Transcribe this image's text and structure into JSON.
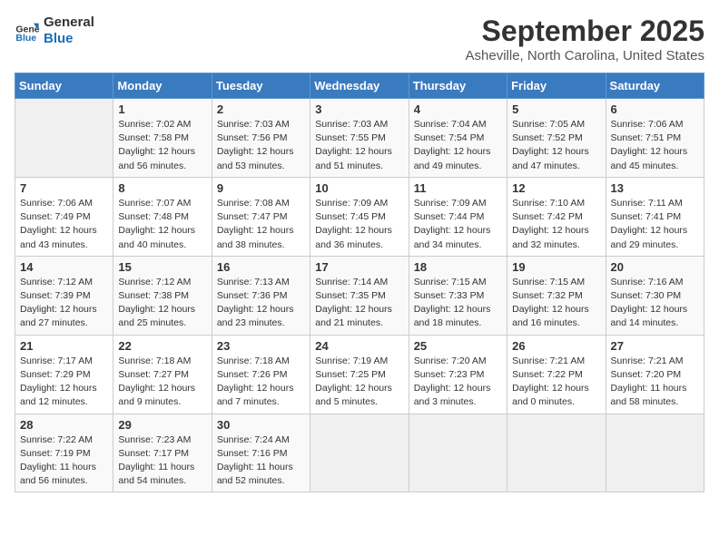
{
  "logo": {
    "line1": "General",
    "line2": "Blue"
  },
  "title": "September 2025",
  "location": "Asheville, North Carolina, United States",
  "headers": [
    "Sunday",
    "Monday",
    "Tuesday",
    "Wednesday",
    "Thursday",
    "Friday",
    "Saturday"
  ],
  "weeks": [
    [
      {
        "day": "",
        "info": ""
      },
      {
        "day": "1",
        "info": "Sunrise: 7:02 AM\nSunset: 7:58 PM\nDaylight: 12 hours\nand 56 minutes."
      },
      {
        "day": "2",
        "info": "Sunrise: 7:03 AM\nSunset: 7:56 PM\nDaylight: 12 hours\nand 53 minutes."
      },
      {
        "day": "3",
        "info": "Sunrise: 7:03 AM\nSunset: 7:55 PM\nDaylight: 12 hours\nand 51 minutes."
      },
      {
        "day": "4",
        "info": "Sunrise: 7:04 AM\nSunset: 7:54 PM\nDaylight: 12 hours\nand 49 minutes."
      },
      {
        "day": "5",
        "info": "Sunrise: 7:05 AM\nSunset: 7:52 PM\nDaylight: 12 hours\nand 47 minutes."
      },
      {
        "day": "6",
        "info": "Sunrise: 7:06 AM\nSunset: 7:51 PM\nDaylight: 12 hours\nand 45 minutes."
      }
    ],
    [
      {
        "day": "7",
        "info": "Sunrise: 7:06 AM\nSunset: 7:49 PM\nDaylight: 12 hours\nand 43 minutes."
      },
      {
        "day": "8",
        "info": "Sunrise: 7:07 AM\nSunset: 7:48 PM\nDaylight: 12 hours\nand 40 minutes."
      },
      {
        "day": "9",
        "info": "Sunrise: 7:08 AM\nSunset: 7:47 PM\nDaylight: 12 hours\nand 38 minutes."
      },
      {
        "day": "10",
        "info": "Sunrise: 7:09 AM\nSunset: 7:45 PM\nDaylight: 12 hours\nand 36 minutes."
      },
      {
        "day": "11",
        "info": "Sunrise: 7:09 AM\nSunset: 7:44 PM\nDaylight: 12 hours\nand 34 minutes."
      },
      {
        "day": "12",
        "info": "Sunrise: 7:10 AM\nSunset: 7:42 PM\nDaylight: 12 hours\nand 32 minutes."
      },
      {
        "day": "13",
        "info": "Sunrise: 7:11 AM\nSunset: 7:41 PM\nDaylight: 12 hours\nand 29 minutes."
      }
    ],
    [
      {
        "day": "14",
        "info": "Sunrise: 7:12 AM\nSunset: 7:39 PM\nDaylight: 12 hours\nand 27 minutes."
      },
      {
        "day": "15",
        "info": "Sunrise: 7:12 AM\nSunset: 7:38 PM\nDaylight: 12 hours\nand 25 minutes."
      },
      {
        "day": "16",
        "info": "Sunrise: 7:13 AM\nSunset: 7:36 PM\nDaylight: 12 hours\nand 23 minutes."
      },
      {
        "day": "17",
        "info": "Sunrise: 7:14 AM\nSunset: 7:35 PM\nDaylight: 12 hours\nand 21 minutes."
      },
      {
        "day": "18",
        "info": "Sunrise: 7:15 AM\nSunset: 7:33 PM\nDaylight: 12 hours\nand 18 minutes."
      },
      {
        "day": "19",
        "info": "Sunrise: 7:15 AM\nSunset: 7:32 PM\nDaylight: 12 hours\nand 16 minutes."
      },
      {
        "day": "20",
        "info": "Sunrise: 7:16 AM\nSunset: 7:30 PM\nDaylight: 12 hours\nand 14 minutes."
      }
    ],
    [
      {
        "day": "21",
        "info": "Sunrise: 7:17 AM\nSunset: 7:29 PM\nDaylight: 12 hours\nand 12 minutes."
      },
      {
        "day": "22",
        "info": "Sunrise: 7:18 AM\nSunset: 7:27 PM\nDaylight: 12 hours\nand 9 minutes."
      },
      {
        "day": "23",
        "info": "Sunrise: 7:18 AM\nSunset: 7:26 PM\nDaylight: 12 hours\nand 7 minutes."
      },
      {
        "day": "24",
        "info": "Sunrise: 7:19 AM\nSunset: 7:25 PM\nDaylight: 12 hours\nand 5 minutes."
      },
      {
        "day": "25",
        "info": "Sunrise: 7:20 AM\nSunset: 7:23 PM\nDaylight: 12 hours\nand 3 minutes."
      },
      {
        "day": "26",
        "info": "Sunrise: 7:21 AM\nSunset: 7:22 PM\nDaylight: 12 hours\nand 0 minutes."
      },
      {
        "day": "27",
        "info": "Sunrise: 7:21 AM\nSunset: 7:20 PM\nDaylight: 11 hours\nand 58 minutes."
      }
    ],
    [
      {
        "day": "28",
        "info": "Sunrise: 7:22 AM\nSunset: 7:19 PM\nDaylight: 11 hours\nand 56 minutes."
      },
      {
        "day": "29",
        "info": "Sunrise: 7:23 AM\nSunset: 7:17 PM\nDaylight: 11 hours\nand 54 minutes."
      },
      {
        "day": "30",
        "info": "Sunrise: 7:24 AM\nSunset: 7:16 PM\nDaylight: 11 hours\nand 52 minutes."
      },
      {
        "day": "",
        "info": ""
      },
      {
        "day": "",
        "info": ""
      },
      {
        "day": "",
        "info": ""
      },
      {
        "day": "",
        "info": ""
      }
    ]
  ]
}
